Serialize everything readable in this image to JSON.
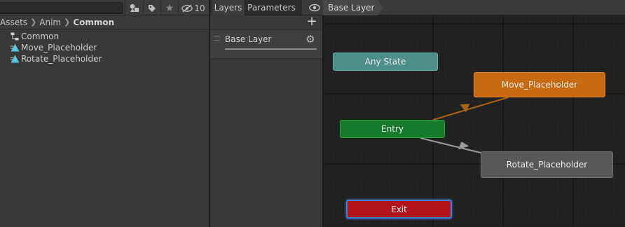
{
  "project": {
    "toolbar": {
      "hidden_count": "10"
    },
    "breadcrumb": {
      "items": [
        "Assets",
        "Anim",
        "Common"
      ]
    },
    "items": [
      {
        "label": "Common",
        "icon": "animator-controller-icon"
      },
      {
        "label": "Move_Placeholder",
        "icon": "animation-clip-icon"
      },
      {
        "label": "Rotate_Placeholder",
        "icon": "animation-clip-icon"
      }
    ]
  },
  "layers_panel": {
    "tabs": [
      "Layers",
      "Parameters"
    ],
    "layers": [
      {
        "name": "Base Layer"
      }
    ]
  },
  "graph": {
    "breadcrumb": "Base Layer",
    "states": {
      "any": "Any State",
      "move": "Move_Placeholder",
      "entry": "Entry",
      "rotate": "Rotate_Placeholder",
      "exit": "Exit"
    }
  },
  "colors": {
    "any_state": "#4d8f88",
    "default_state": "#c86a12",
    "entry": "#167a2c",
    "state": "#585858",
    "exit": "#b3141b",
    "selection": "#3b7fd6",
    "transition_default": "#a86514",
    "transition": "#9a9a9a"
  }
}
